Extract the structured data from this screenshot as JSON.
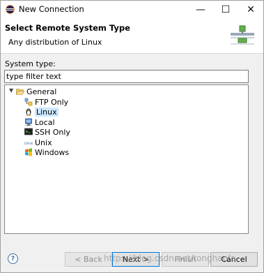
{
  "window": {
    "title": "New Connection",
    "min_glyph": "—",
    "max_glyph": "☐",
    "close_glyph": "✕"
  },
  "header": {
    "title": "Select Remote System Type",
    "description": "Any distribution of Linux",
    "icon": "wizard-connection-icon"
  },
  "filter": {
    "label": "System type:",
    "value": "type filter text"
  },
  "tree": {
    "root": {
      "label": "General",
      "icon": "folder-open-icon",
      "expanded": true
    },
    "items": [
      {
        "label": "FTP Only",
        "icon": "ftp-icon",
        "selected": false
      },
      {
        "label": "Linux",
        "icon": "linux-penguin-icon",
        "selected": true
      },
      {
        "label": "Local",
        "icon": "local-computer-icon",
        "selected": false
      },
      {
        "label": "SSH Only",
        "icon": "ssh-icon",
        "selected": false
      },
      {
        "label": "Unix",
        "icon": "unix-icon",
        "selected": false
      },
      {
        "label": "Windows",
        "icon": "windows-icon",
        "selected": false
      }
    ]
  },
  "footer": {
    "help": "?",
    "back": "< Back",
    "next": "Next >",
    "finish": "Finish",
    "cancel": "Cancel"
  },
  "watermark": "https://blog.csdn.net/tonghaofa",
  "colors": {
    "selection": "#cde8ff",
    "default_button_border": "#0078d7",
    "dialog_bg": "#f0f0f0"
  }
}
